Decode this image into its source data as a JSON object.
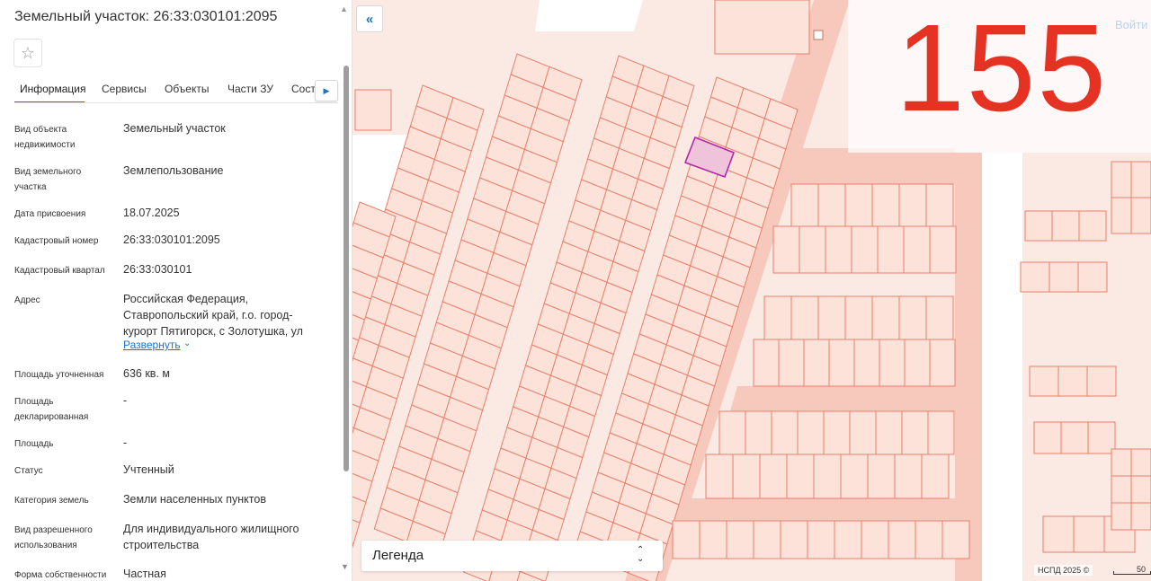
{
  "panel": {
    "title": "Земельный участок: 26:33:030101:2095",
    "favorite_icon": "star-icon",
    "tabs": [
      "Информация",
      "Сервисы",
      "Объекты",
      "Части ЗУ",
      "Состав ЕЗ"
    ],
    "active_tab": "Информация",
    "properties": [
      {
        "label": "Вид объекта недвижимости",
        "value": "Земельный участок"
      },
      {
        "label": "Вид земельного участка",
        "value": "Землепользование"
      },
      {
        "label": "Дата присвоения",
        "value": "18.07.2025"
      },
      {
        "label": "Кадастровый номер",
        "value": "26:33:030101:2095"
      },
      {
        "label": "Кадастровый квартал",
        "value": "26:33:030101"
      },
      {
        "label": "Адрес",
        "value": "Российская Федерация, Ставропольский край, г.о. город-курорт Пятигорск, с Золотушка, ул"
      },
      {
        "label": "Площадь уточненная",
        "value": "636 кв. м"
      },
      {
        "label": "Площадь декларированная",
        "value": "-"
      },
      {
        "label": "Площадь",
        "value": "-"
      },
      {
        "label": "Статус",
        "value": "Учтенный"
      },
      {
        "label": "Категория земель",
        "value": "Земли населенных пунктов"
      },
      {
        "label": "Вид разрешенного использования",
        "value": "Для индивидуального жилищного строительства"
      },
      {
        "label": "Форма собственности",
        "value": "Частная"
      }
    ],
    "address_expand": "Развернуть"
  },
  "map": {
    "big_number": "155",
    "login": "Войти",
    "legend": "Легенда",
    "copyright": "НСПД 2025 ©",
    "scale": "50",
    "colors": {
      "background": "#fbe9e4",
      "parcel_fill": "#fde2da",
      "parcel_stroke": "#e8806a",
      "road": "#f7c9bd",
      "selected_fill": "#efc3da",
      "selected_stroke": "#b02aa8",
      "big_number": "#e63223"
    }
  }
}
